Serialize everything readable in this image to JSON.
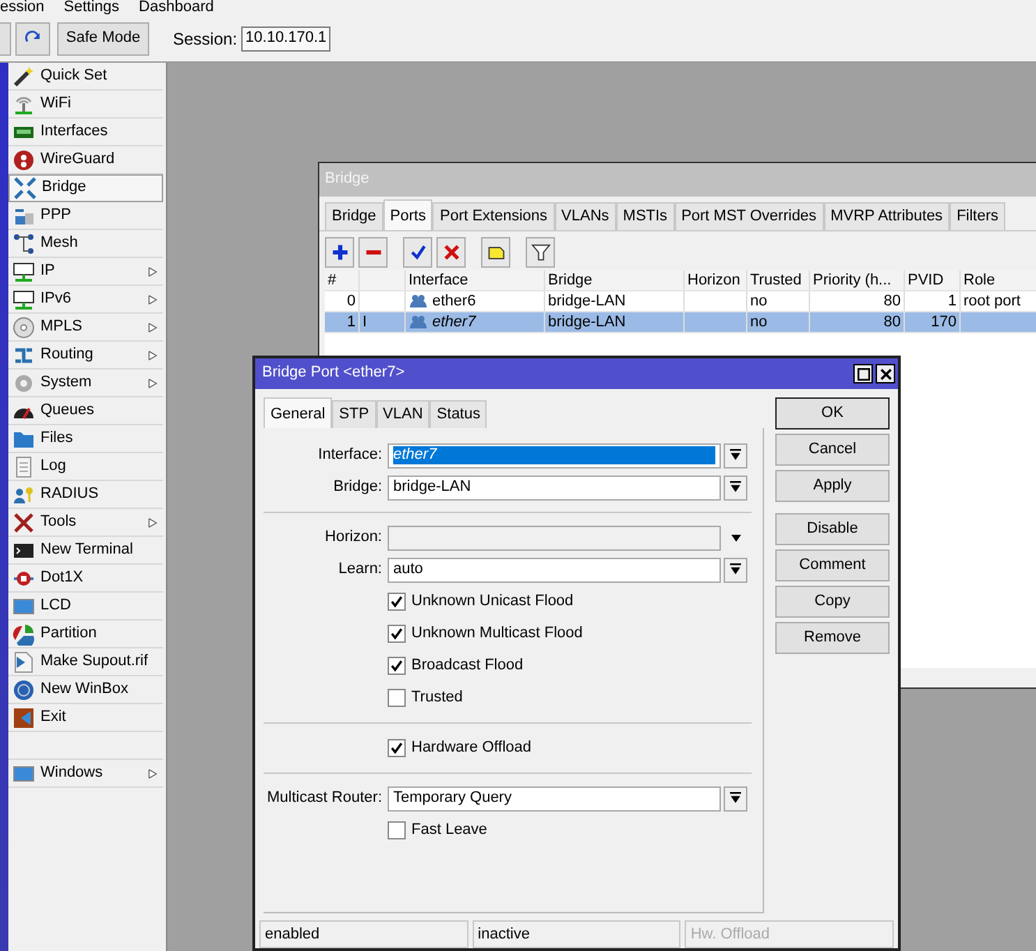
{
  "menu_bar": [
    "ession",
    "Settings",
    "Dashboard"
  ],
  "toolbar": {
    "safe_mode": "Safe Mode",
    "session_label": "Session:",
    "session": "10.10.170.1"
  },
  "sidebar": {
    "items": [
      {
        "label": "Quick Set",
        "selected": false,
        "submenu": false
      },
      {
        "label": "WiFi",
        "selected": false,
        "submenu": false
      },
      {
        "label": "Interfaces",
        "selected": false,
        "submenu": false
      },
      {
        "label": "WireGuard",
        "selected": false,
        "submenu": false
      },
      {
        "label": "Bridge",
        "selected": true,
        "submenu": false
      },
      {
        "label": "PPP",
        "selected": false,
        "submenu": false
      },
      {
        "label": "Mesh",
        "selected": false,
        "submenu": false
      },
      {
        "label": "IP",
        "selected": false,
        "submenu": true
      },
      {
        "label": "IPv6",
        "selected": false,
        "submenu": true
      },
      {
        "label": "MPLS",
        "selected": false,
        "submenu": true
      },
      {
        "label": "Routing",
        "selected": false,
        "submenu": true
      },
      {
        "label": "System",
        "selected": false,
        "submenu": true
      },
      {
        "label": "Queues",
        "selected": false,
        "submenu": false
      },
      {
        "label": "Files",
        "selected": false,
        "submenu": false
      },
      {
        "label": "Log",
        "selected": false,
        "submenu": false
      },
      {
        "label": "RADIUS",
        "selected": false,
        "submenu": false
      },
      {
        "label": "Tools",
        "selected": false,
        "submenu": true
      },
      {
        "label": "New Terminal",
        "selected": false,
        "submenu": false
      },
      {
        "label": "Dot1X",
        "selected": false,
        "submenu": false
      },
      {
        "label": "LCD",
        "selected": false,
        "submenu": false
      },
      {
        "label": "Partition",
        "selected": false,
        "submenu": false
      },
      {
        "label": "Make Supout.rif",
        "selected": false,
        "submenu": false
      },
      {
        "label": "New WinBox",
        "selected": false,
        "submenu": false
      },
      {
        "label": "Exit",
        "selected": false,
        "submenu": false
      },
      {
        "label": "Windows",
        "selected": false,
        "submenu": true
      }
    ]
  },
  "bridge_window": {
    "title": "Bridge",
    "tabs": [
      {
        "label": "Bridge",
        "selected": false
      },
      {
        "label": "Ports",
        "selected": true
      },
      {
        "label": "Port Extensions",
        "selected": false
      },
      {
        "label": "VLANs",
        "selected": false
      },
      {
        "label": "MSTIs",
        "selected": false
      },
      {
        "label": "Port MST Overrides",
        "selected": false
      },
      {
        "label": "MVRP Attributes",
        "selected": false
      },
      {
        "label": "Filters",
        "selected": false
      }
    ],
    "table": {
      "columns": [
        "#",
        "",
        "Interface",
        "Bridge",
        "Horizon",
        "Trusted",
        "Priority (h...",
        "PVID",
        "Role"
      ],
      "rows": [
        {
          "cells": [
            "0",
            "",
            "ether6",
            "bridge-LAN",
            "",
            "no",
            "80",
            "1",
            "root port"
          ],
          "selected": false,
          "inactive": false
        },
        {
          "cells": [
            "1",
            "I",
            "ether7",
            "bridge-LAN",
            "",
            "no",
            "80",
            "170",
            ""
          ],
          "selected": true,
          "inactive": true
        }
      ]
    }
  },
  "port_dialog": {
    "title": "Bridge Port <ether7>",
    "tabs": [
      {
        "label": "General",
        "selected": true
      },
      {
        "label": "STP",
        "selected": false
      },
      {
        "label": "VLAN",
        "selected": false
      },
      {
        "label": "Status",
        "selected": false
      }
    ],
    "fields": [
      {
        "kind": "select",
        "label": "Interface:",
        "value": "ether7",
        "focused": true
      },
      {
        "kind": "select",
        "label": "Bridge:",
        "value": "bridge-LAN",
        "focused": false
      },
      {
        "kind": "separator"
      },
      {
        "kind": "combo",
        "label": "Horizon:",
        "disabled": true
      },
      {
        "kind": "select",
        "label": "Learn:",
        "value": "auto",
        "focused": false
      },
      {
        "kind": "checkbox",
        "label": "Unknown Unicast Flood",
        "checked": true
      },
      {
        "kind": "checkbox",
        "label": "Unknown Multicast Flood",
        "checked": true
      },
      {
        "kind": "checkbox",
        "label": "Broadcast Flood",
        "checked": true
      },
      {
        "kind": "checkbox",
        "label": "Trusted",
        "checked": false
      },
      {
        "kind": "separator"
      },
      {
        "kind": "checkbox",
        "label": "Hardware Offload",
        "checked": true
      },
      {
        "kind": "separator"
      },
      {
        "kind": "select",
        "label": "Multicast Router:",
        "value": "Temporary Query",
        "focused": false
      },
      {
        "kind": "checkbox",
        "label": "Fast Leave",
        "checked": false
      }
    ],
    "button_groups": [
      [
        {
          "label": "OK",
          "default": true
        },
        {
          "label": "Cancel",
          "default": false
        },
        {
          "label": "Apply",
          "default": false
        }
      ],
      [
        {
          "label": "Disable",
          "default": false
        },
        {
          "label": "Comment",
          "default": false
        },
        {
          "label": "Copy",
          "default": false
        },
        {
          "label": "Remove",
          "default": false
        }
      ]
    ],
    "status_bar": [
      {
        "text": "enabled",
        "disabled": false
      },
      {
        "text": "inactive",
        "disabled": false
      },
      {
        "text": "Hw. Offload",
        "disabled": true
      }
    ]
  }
}
